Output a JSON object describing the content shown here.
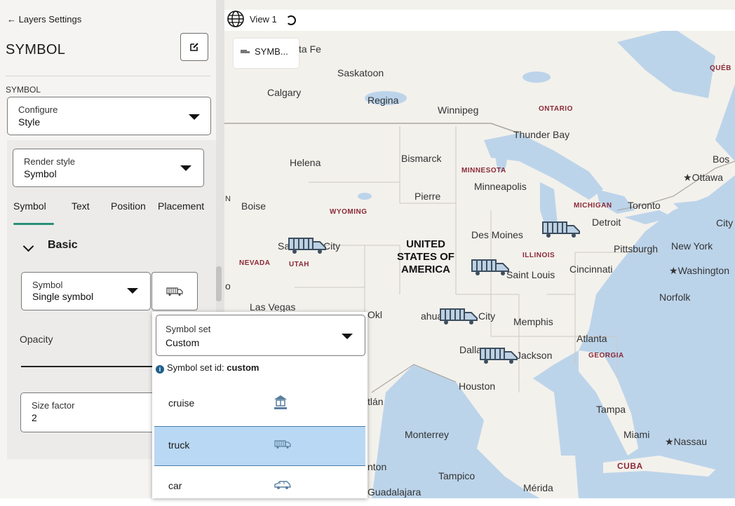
{
  "panel": {
    "back_label": "← Layers Settings",
    "title": "SYMBOL",
    "section_label": "SYMBOL",
    "configure": {
      "label": "Configure",
      "value": "Style"
    },
    "render_style": {
      "label": "Render style",
      "value": "Symbol"
    },
    "tabs": [
      "Symbol",
      "Text",
      "Position",
      "Placement"
    ],
    "active_tab": "Symbol",
    "basic_heading": "Basic",
    "symbol": {
      "label": "Symbol",
      "value": "Single symbol"
    },
    "opacity_label": "Opacity",
    "size_factor": {
      "label": "Size factor",
      "value": "2"
    }
  },
  "map": {
    "view_title": "View 1",
    "legend_label": "SYMB...",
    "cities": [
      "Saskatoon",
      "Calgary",
      "Regina",
      "Winnipeg",
      "Thunder Bay",
      "Helena",
      "Bismarck",
      "Minneapolis",
      "Pierre",
      "Boise",
      "Toronto",
      "Detroit",
      "Des Moines",
      "Pittsburgh",
      "New York",
      "Cincinnati",
      "Washington",
      "Saint Louis",
      "Las Vegas",
      "Norfolk",
      "Memphis",
      "Atlanta",
      "Dallas",
      "Jackson",
      "Houston",
      "Tampa",
      "Miami",
      "Nassau",
      "Monterrey",
      "Tampico",
      "Mérida",
      "Guadalajara",
      "Ottawa",
      "Qué",
      "Bos",
      "City",
      "ta Fe",
      "Okl",
      "ahua",
      "tlán",
      "nton",
      "N",
      "o",
      "Sa",
      "City"
    ],
    "regions": [
      "ONTARIO",
      "MINNESOTA",
      "WYOMING",
      "MICHIGAN",
      "NEVADA",
      "UTAH",
      "ILLINOIS",
      "GEORGIA",
      "CUBA",
      "QUÉB"
    ],
    "country": "UNITED\nSTATES OF\nAMERICA",
    "colors": {
      "water": "#bcd4ea",
      "land": "#f3f1ec",
      "border": "#b8b5ae",
      "state_label": "#8a2a38"
    }
  },
  "dropdown": {
    "symbol_set": {
      "label": "Symbol set",
      "value": "Custom"
    },
    "info_prefix": "Symbol set id: ",
    "info_value": "custom",
    "options": [
      {
        "label": "cruise",
        "icon": "cruise-ship-icon",
        "selected": false
      },
      {
        "label": "truck",
        "icon": "truck-icon",
        "selected": true
      },
      {
        "label": "car",
        "icon": "car-icon",
        "selected": false
      }
    ]
  }
}
